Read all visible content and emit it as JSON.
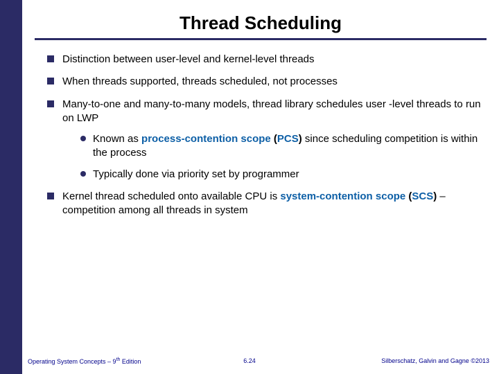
{
  "title": "Thread Scheduling",
  "bullets": {
    "b1": "Distinction between user-level and kernel-level threads",
    "b2": "When threads supported, threads scheduled, not processes",
    "b3": "Many-to-one and many-to-many models, thread library schedules user -level threads to run on LWP",
    "b3s1_pre": "Known as ",
    "b3s1_hl1": "process-contention scope ",
    "b3s1_paren_open": "(",
    "b3s1_hl2": "PCS",
    "b3s1_paren_close": ")",
    "b3s1_post": " since scheduling competition is within the process",
    "b3s2": "Typically done via priority set by programmer",
    "b4_pre": "Kernel thread scheduled onto available CPU is ",
    "b4_hl1": "system-contention scope ",
    "b4_paren_open": "(",
    "b4_hl2": "SCS",
    "b4_paren_close": ")",
    "b4_post": " – competition among all threads in system"
  },
  "footer": {
    "left_pre": "Operating System Concepts – 9",
    "left_sup": "th",
    "left_post": " Edition",
    "center": "6.24",
    "right": "Silberschatz, Galvin and Gagne ©2013"
  }
}
